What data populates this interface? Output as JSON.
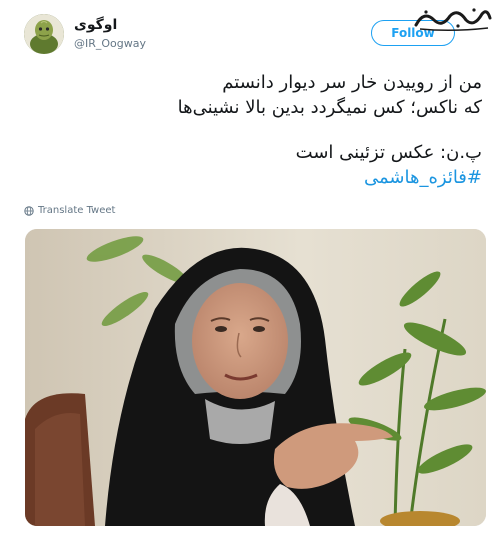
{
  "user": {
    "display_name": "اوگوی",
    "handle": "@IR_Oogway",
    "avatar_icon": "turtle-avatar"
  },
  "follow_button": {
    "label": "Follow"
  },
  "watermark": {
    "text": "شهدای ایران"
  },
  "tweet": {
    "lines": [
      "من از روییدن خار سر دیوار دانستم",
      "که ناکس؛ کس نمیگردد بدین بالا نشینی‌ها"
    ],
    "note": "پ.ن: عکس تزئینی است",
    "hashtag": "#فائزه_هاشمی"
  },
  "translate": {
    "icon": "globe-icon",
    "label": "Translate Tweet"
  },
  "colors": {
    "accent": "#1da1f2",
    "hashtag": "#1b95e0",
    "text": "#14171a",
    "muted": "#657786"
  }
}
